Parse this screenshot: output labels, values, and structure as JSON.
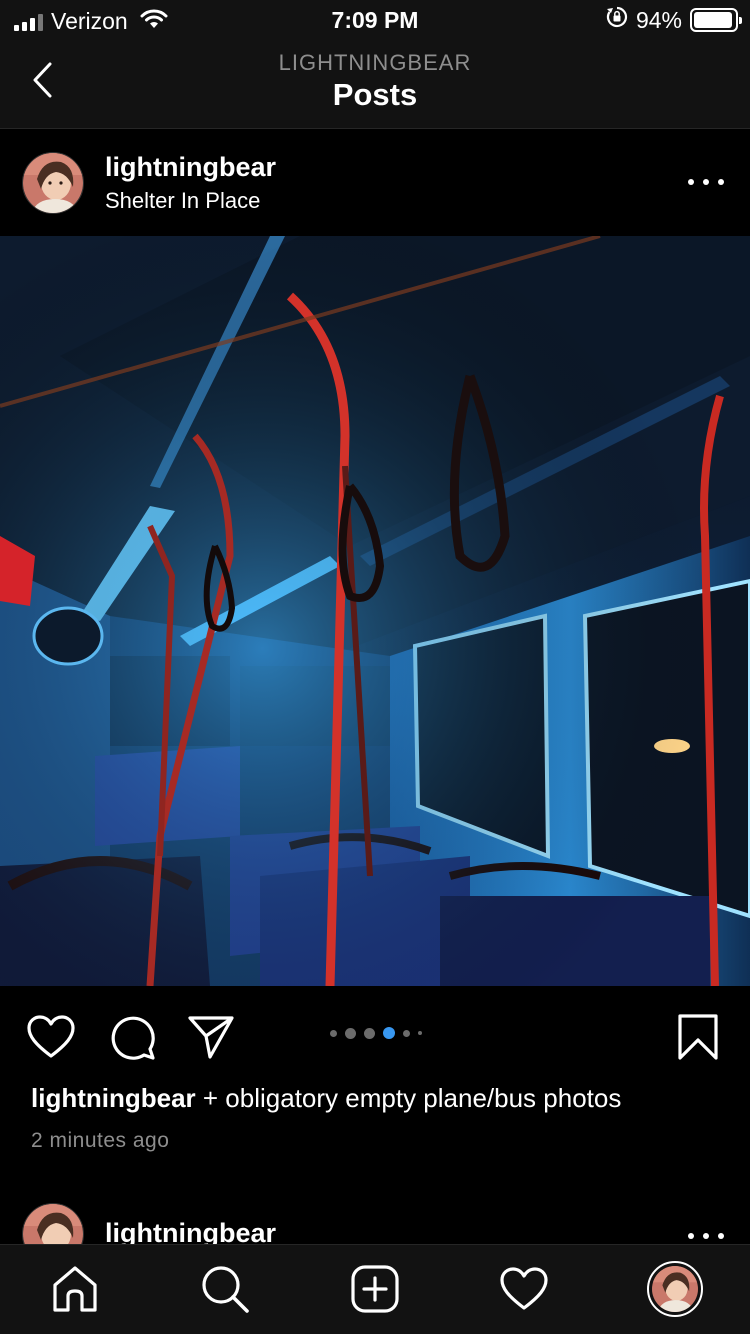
{
  "status_bar": {
    "carrier": "Verizon",
    "time": "7:09 PM",
    "battery_percent": "94%",
    "battery_level": 0.94,
    "signal_bars_active": 3,
    "icons": [
      "signal-icon",
      "wifi-icon",
      "orientation-lock-icon",
      "battery-icon"
    ]
  },
  "nav": {
    "subtitle": "LIGHTNINGBEAR",
    "title": "Posts",
    "back_icon": "chevron-left-icon"
  },
  "post": {
    "username": "lightningbear",
    "location": "Shelter In Place",
    "photo_description_icon": "bus-interior-photo",
    "carousel": {
      "count": 6,
      "active_index": 3
    },
    "caption_username": "lightningbear",
    "caption_text": " + obligatory empty plane/bus photos",
    "time_ago": "2 minutes ago"
  },
  "actions": {
    "icons": [
      "heart-icon",
      "comment-icon",
      "share-icon",
      "bookmark-icon"
    ]
  },
  "next_post": {
    "username": "lightningbear"
  },
  "tab_bar": {
    "icons": [
      "home-icon",
      "search-icon",
      "new-post-icon",
      "activity-icon",
      "profile-avatar"
    ]
  },
  "colors": {
    "background": "#000000",
    "bar_background": "#121212",
    "accent_blue": "#3897f0",
    "muted_text": "#8e8e8e"
  }
}
